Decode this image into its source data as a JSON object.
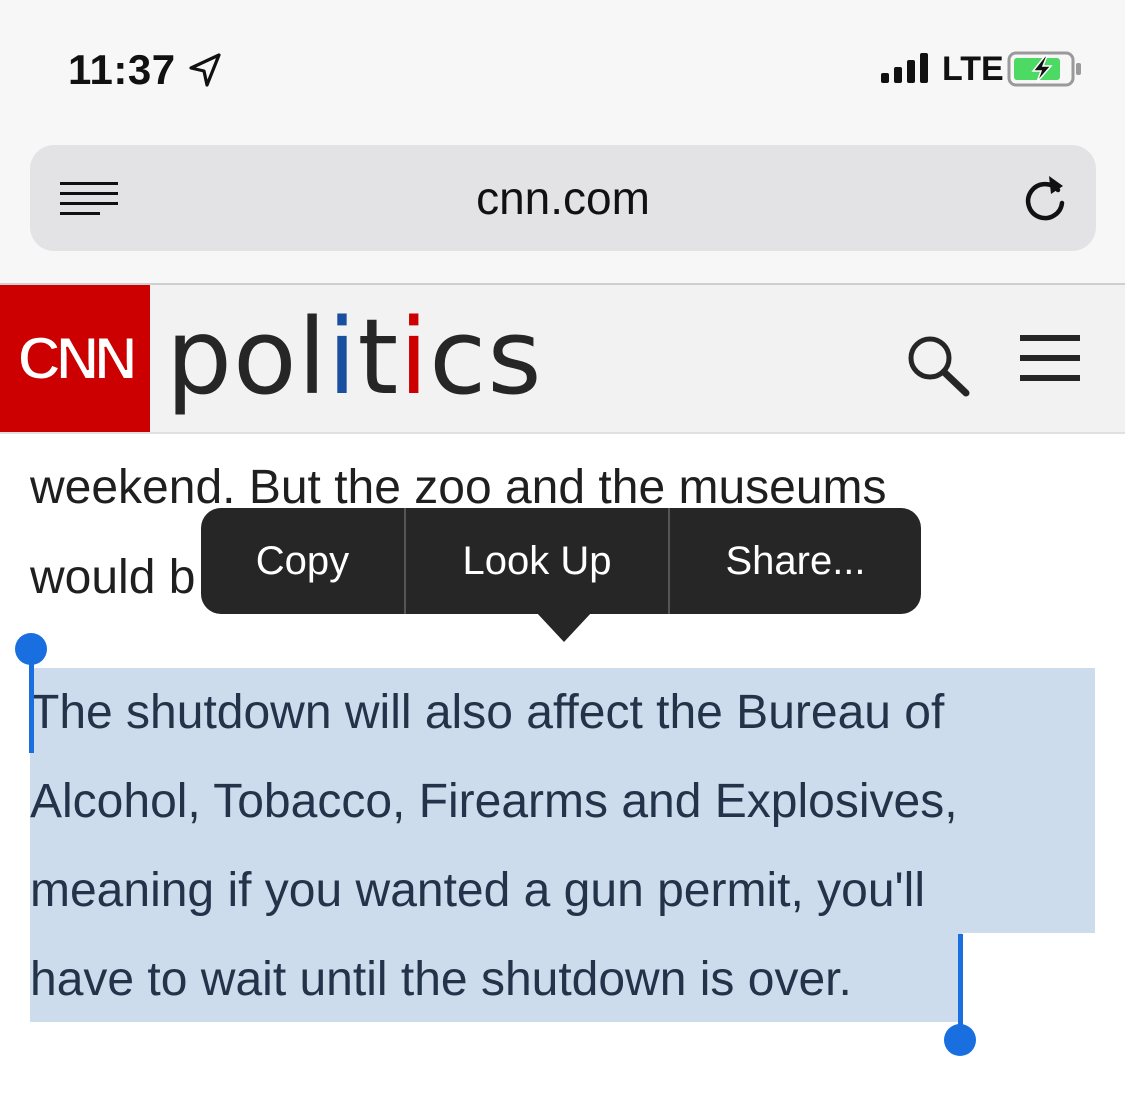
{
  "status_bar": {
    "time": "11:37",
    "network": "LTE",
    "battery_charging": true,
    "icons": [
      "location-arrow-icon",
      "signal-bars-icon",
      "battery-charging-icon"
    ]
  },
  "browser": {
    "url": "cnn.com",
    "icons": [
      "reader-view-icon",
      "reload-icon"
    ]
  },
  "site_header": {
    "logo_text": "CNN",
    "section_parts": [
      "pol",
      "i",
      "t",
      "i",
      "cs"
    ],
    "colors": {
      "logo_bg": "#cc0000",
      "accent_blue": "#1a4f9f",
      "accent_red": "#cc0000"
    },
    "icons": [
      "search-icon",
      "hamburger-menu-icon"
    ]
  },
  "article": {
    "line1": "weekend. But the zoo and the museums",
    "line2": "would b",
    "selected_lines": [
      "The shutdown will also affect the Bureau of",
      "Alcohol, Tobacco, Firearms and Explosives,",
      "meaning if you wanted a gun permit, you'll",
      "have to wait until the shutdown is over."
    ],
    "selection_color": "#ccdcec"
  },
  "context_menu": {
    "copy": "Copy",
    "look_up": "Look Up",
    "share": "Share..."
  }
}
